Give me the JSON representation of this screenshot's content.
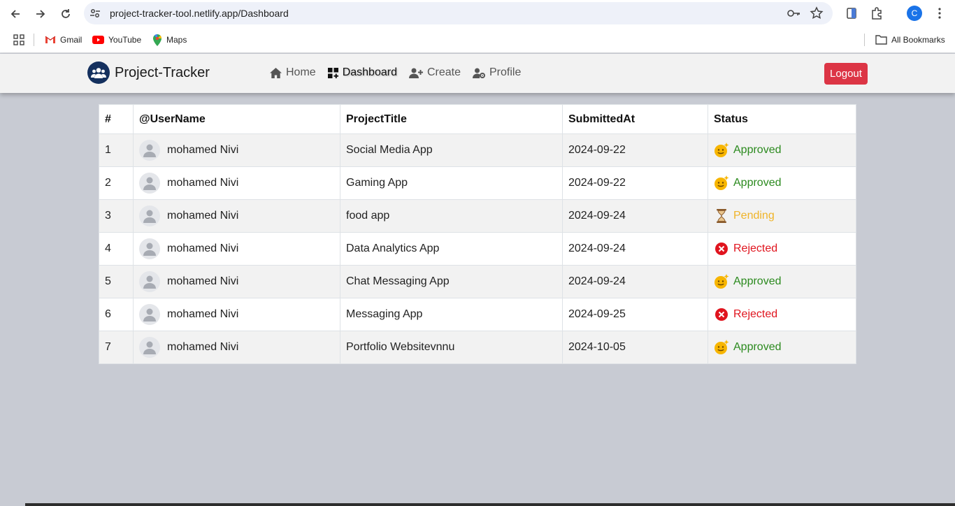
{
  "browser": {
    "url": "project-tracker-tool.netlify.app/Dashboard",
    "profile_initial": "C",
    "bookmarks": [
      {
        "label": "Gmail",
        "icon": "gmail-icon"
      },
      {
        "label": "YouTube",
        "icon": "youtube-icon"
      },
      {
        "label": "Maps",
        "icon": "maps-icon"
      }
    ],
    "all_bookmarks": "All Bookmarks"
  },
  "app": {
    "brand": "Project-Tracker",
    "nav": [
      {
        "label": "Home",
        "icon": "home-icon"
      },
      {
        "label": "Dashboard",
        "icon": "dashboard-icon",
        "active": true
      },
      {
        "label": "Create",
        "icon": "user-plus-icon"
      },
      {
        "label": "Profile",
        "icon": "user-gear-icon"
      }
    ],
    "logout_label": "Logout",
    "colors": {
      "brand": "#14305e",
      "logout": "#dc3545",
      "approved": "#2b8a1e",
      "pending": "#f0b429",
      "rejected": "#e0141e"
    }
  },
  "table": {
    "headers": [
      "#",
      "@UserName",
      "ProjectTitle",
      "SubmittedAt",
      "Status"
    ],
    "rows": [
      {
        "num": "1",
        "user": "mohamed Nivi",
        "title": "Social Media App",
        "date": "2024-09-22",
        "status": "Approved"
      },
      {
        "num": "2",
        "user": "mohamed Nivi",
        "title": "Gaming App",
        "date": "2024-09-22",
        "status": "Approved"
      },
      {
        "num": "3",
        "user": "mohamed Nivi",
        "title": "food app",
        "date": "2024-09-24",
        "status": "Pending"
      },
      {
        "num": "4",
        "user": "mohamed Nivi",
        "title": "Data Analytics App",
        "date": "2024-09-24",
        "status": "Rejected"
      },
      {
        "num": "5",
        "user": "mohamed Nivi",
        "title": "Chat Messaging App",
        "date": "2024-09-24",
        "status": "Approved"
      },
      {
        "num": "6",
        "user": "mohamed Nivi",
        "title": "Messaging App",
        "date": "2024-09-25",
        "status": "Rejected"
      },
      {
        "num": "7",
        "user": "mohamed Nivi",
        "title": "Portfolio Websitevnnu",
        "date": "2024-10-05",
        "status": "Approved"
      }
    ]
  }
}
